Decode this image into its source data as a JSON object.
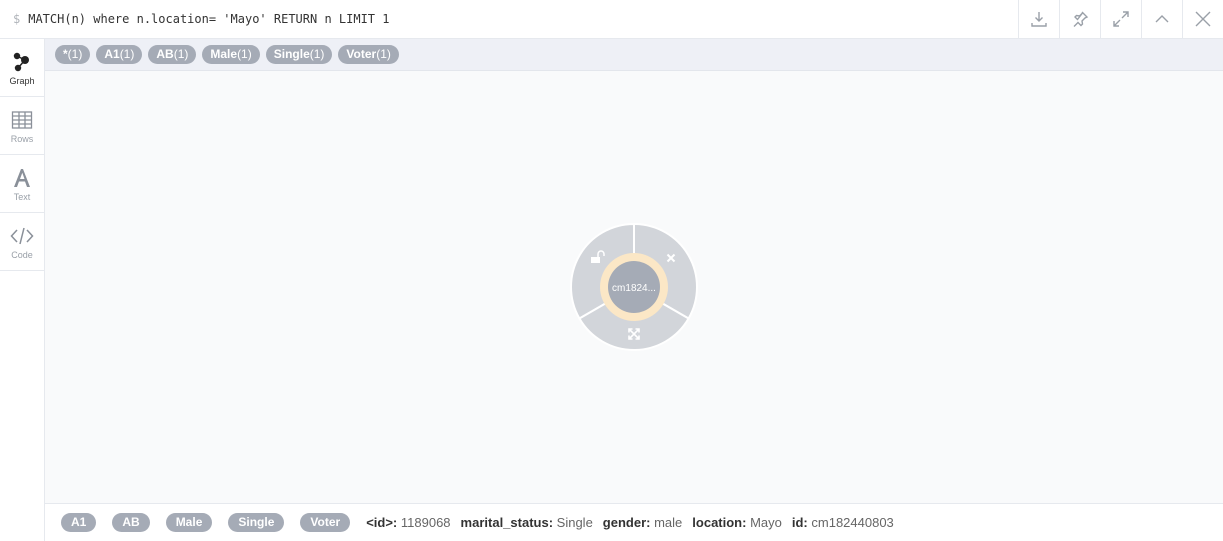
{
  "query": {
    "prompt": "$",
    "text": "MATCH(n) where n.location= 'Mayo' RETURN n LIMIT 1"
  },
  "toolbar": {
    "icons": [
      "download-icon",
      "pin-icon",
      "expand-icon",
      "collapse-icon",
      "close-icon"
    ]
  },
  "sidebar": {
    "tabs": [
      {
        "label": "Graph",
        "icon": "graph-icon",
        "active": true
      },
      {
        "label": "Rows",
        "icon": "table-icon",
        "active": false
      },
      {
        "label": "Text",
        "icon": "text-icon",
        "active": false
      },
      {
        "label": "Code",
        "icon": "code-icon",
        "active": false
      }
    ]
  },
  "labels": [
    {
      "name": "*",
      "count": "(1)"
    },
    {
      "name": "A1",
      "count": "(1)"
    },
    {
      "name": "AB",
      "count": "(1)"
    },
    {
      "name": "Male",
      "count": "(1)"
    },
    {
      "name": "Single",
      "count": "(1)"
    },
    {
      "name": "Voter",
      "count": "(1)"
    }
  ],
  "node": {
    "caption": "cm1824...",
    "ring_actions": [
      "unlock-icon",
      "remove-icon",
      "expand-icon"
    ],
    "colors": {
      "node": "#a5abb6",
      "halo": "#fbe7c6",
      "ring": "#d2d5da"
    }
  },
  "footer": {
    "labels": [
      "A1",
      "AB",
      "Male",
      "Single",
      "Voter"
    ],
    "props": [
      {
        "key": "<id>:",
        "value": "1189068"
      },
      {
        "key": "marital_status:",
        "value": "Single"
      },
      {
        "key": "gender:",
        "value": "male"
      },
      {
        "key": "location:",
        "value": "Mayo"
      },
      {
        "key": "id:",
        "value": "cm182440803"
      }
    ]
  }
}
